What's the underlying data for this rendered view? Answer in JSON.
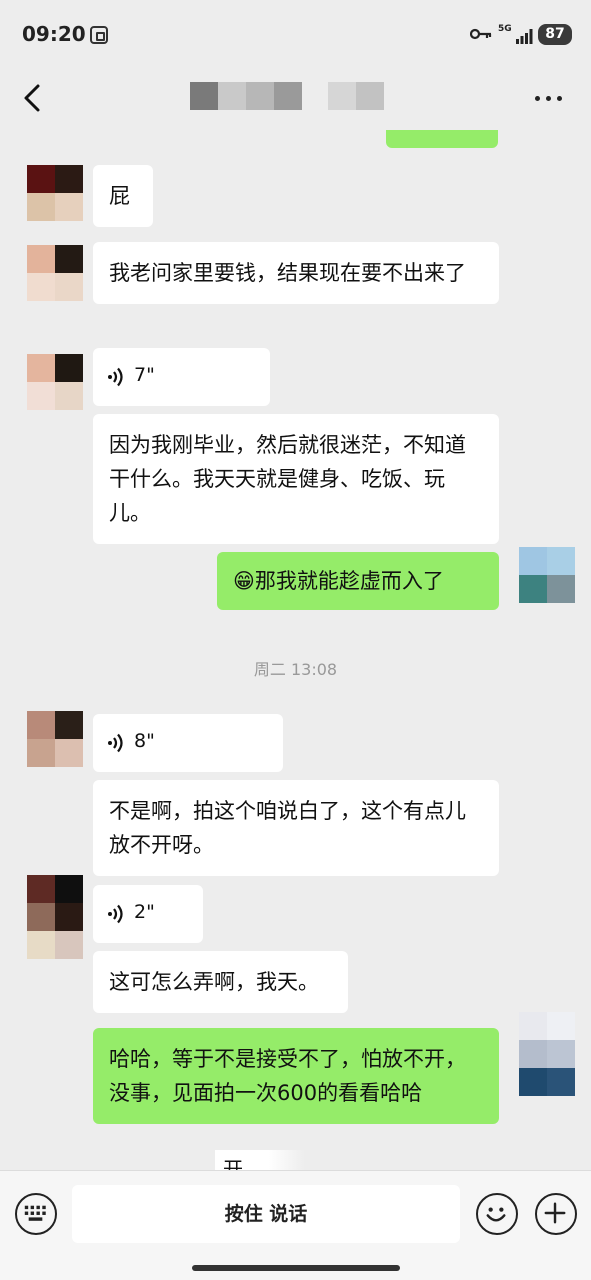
{
  "status_bar": {
    "time": "09:20",
    "network": "5G",
    "battery": "87"
  },
  "chat": {
    "timestamp": "周二 13:08",
    "messages": [
      {
        "id": "m1",
        "from": "them",
        "type": "text",
        "text": "屁"
      },
      {
        "id": "m2",
        "from": "them",
        "type": "text",
        "text": "我老问家里要钱，结果现在要不出来了"
      },
      {
        "id": "m3",
        "from": "them",
        "type": "voice",
        "duration": "7\""
      },
      {
        "id": "m4",
        "from": "them",
        "type": "text",
        "text": "因为我刚毕业，然后就很迷茫，不知道干什么。我天天就是健身、吃饭、玩儿。"
      },
      {
        "id": "m5",
        "from": "me",
        "type": "text",
        "emoji": "😁",
        "text": "那我就能趁虚而入了"
      },
      {
        "id": "m6",
        "from": "them",
        "type": "voice",
        "duration": "8\""
      },
      {
        "id": "m7",
        "from": "them",
        "type": "text",
        "text": "不是啊，拍这个咱说白了，这个有点儿放不开呀。"
      },
      {
        "id": "m8",
        "from": "them",
        "type": "voice",
        "duration": "2\""
      },
      {
        "id": "m9",
        "from": "them",
        "type": "text",
        "text": "这可怎么弄啊，我天。"
      },
      {
        "id": "m10",
        "from": "me",
        "type": "text",
        "text": "哈哈，等于不是接受不了，怕放不开，没事，见面拍一次600的看看哈哈"
      }
    ],
    "overlay_fragment": "开，\n哈哈"
  },
  "input_bar": {
    "hold_to_talk_label": "按住 说话"
  },
  "colors": {
    "background": "#ededed",
    "my_bubble": "#95ec69",
    "their_bubble": "#ffffff"
  },
  "icons": [
    "back-icon",
    "more-icon",
    "keyboard-icon",
    "emoji-icon",
    "plus-icon",
    "voice-wave-icon",
    "key-icon",
    "signal-icon",
    "screen-record-icon"
  ]
}
